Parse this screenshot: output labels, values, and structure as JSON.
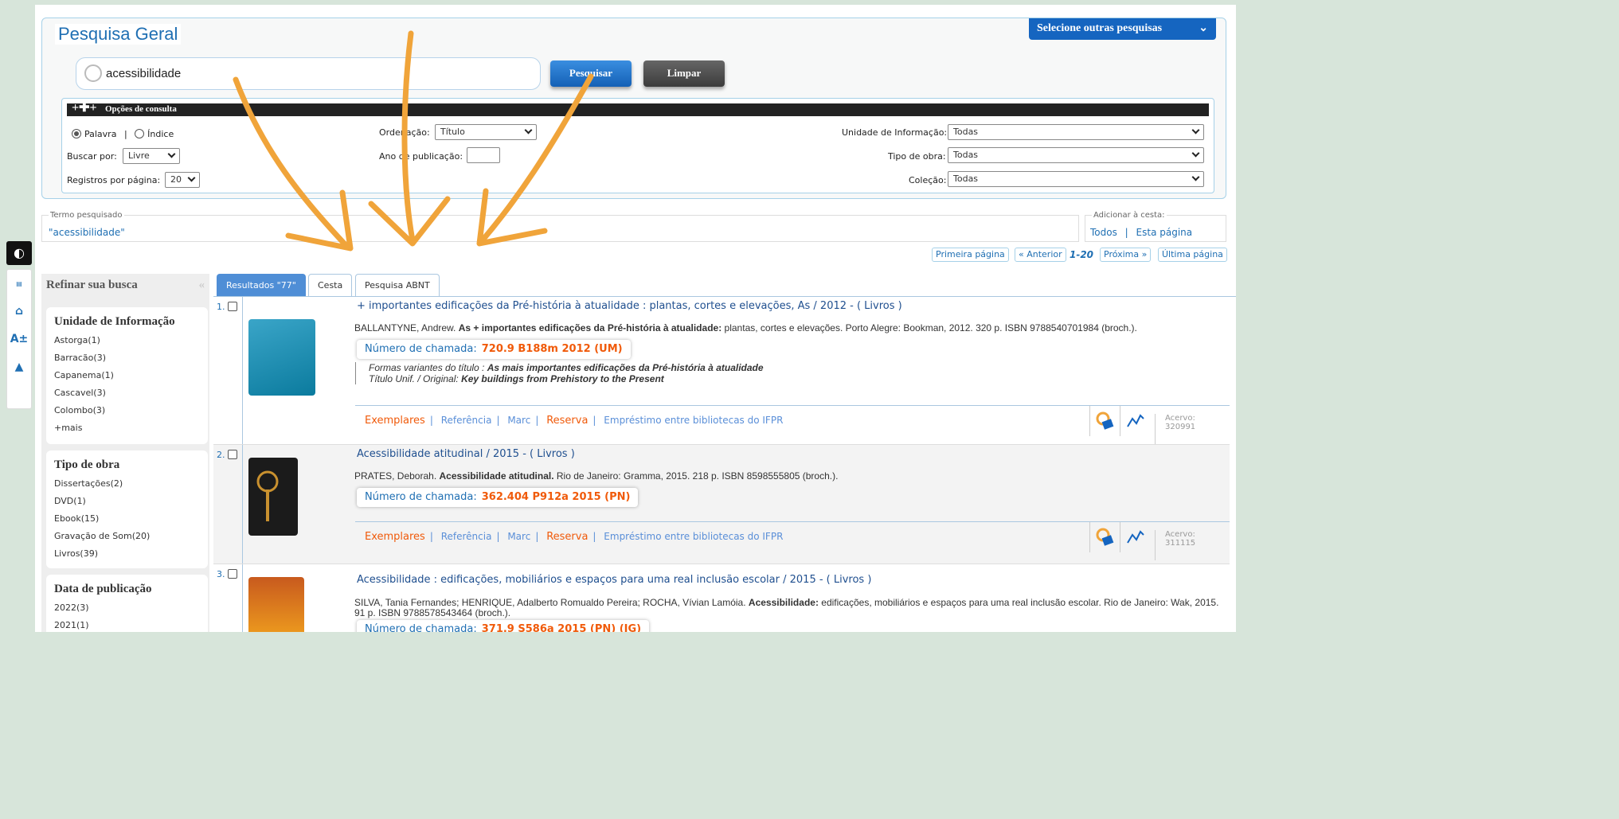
{
  "header": {
    "title": "Pesquisa Geral",
    "other_searches": "Selecione outras pesquisas",
    "search_value": "acessibilidade",
    "search_button": "Pesquisar",
    "clear_button": "Limpar"
  },
  "options": {
    "bar_title": "Opções de consulta",
    "radio_word": "Palavra",
    "radio_index": "Índice",
    "search_by_label": "Buscar por:",
    "search_by_value": "Livre",
    "records_label": "Registros por página:",
    "records_value": "20",
    "order_label": "Ordenação:",
    "order_value": "Título",
    "year_label": "Ano de publicação:",
    "unit_label": "Unidade de Informação:",
    "unit_value": "Todas",
    "type_label": "Tipo de obra:",
    "type_value": "Todas",
    "collection_label": "Coleção:",
    "collection_value": "Todas"
  },
  "term": {
    "label": "Termo pesquisado",
    "value": "\"acessibilidade\"",
    "cart_label": "Adicionar à cesta:",
    "cart_all": "Todos",
    "cart_page": "Esta página"
  },
  "pager": {
    "first": "Primeira página",
    "prev": "« Anterior",
    "current": "1-20",
    "next": "Próxima »",
    "last": "Última página"
  },
  "sidebar": {
    "title": "Refinar sua busca",
    "facets": [
      {
        "title": "Unidade de Informação",
        "items": [
          "Astorga(1)",
          "Barracão(3)",
          "Capanema(1)",
          "Cascavel(3)",
          "Colombo(3)",
          "+mais"
        ]
      },
      {
        "title": "Tipo de obra",
        "items": [
          "Dissertações(2)",
          "DVD(1)",
          "Ebook(15)",
          "Gravação de Som(20)",
          "Livros(39)"
        ]
      },
      {
        "title": "Data de publicação",
        "items": [
          "2022(3)",
          "2021(1)"
        ]
      }
    ]
  },
  "tabs": {
    "results": "Resultados \"77\"",
    "basket": "Cesta",
    "abnt": "Pesquisa ABNT"
  },
  "records": [
    {
      "num": "1.",
      "title": "+ importantes edificações da Pré-história à atualidade : plantas, cortes e elevações, As / 2012 - ( Livros )",
      "ref_author": "BALLANTYNE, Andrew.",
      "ref_bold": "As + importantes edificações da Pré-história à atualidade:",
      "ref_rest": "plantas, cortes e elevações. Porto Alegre: Bookman, 2012. 320 p. ISBN 9788540701984 (broch.).",
      "callno_label": "Número de chamada:",
      "callno": "720.9 B188m 2012 (UM)",
      "variant_label": "Formas variantes do título :",
      "variant_value": "As mais importantes edificações da Pré-história à atualidade",
      "uniform_label": "Título Unif. / Original:",
      "uniform_value": "Key buildings from Prehistory to the Present",
      "acervo_label": "Acervo:",
      "acervo": "320991"
    },
    {
      "num": "2.",
      "title": "Acessibilidade atitudinal / 2015 - ( Livros )",
      "ref_author": "PRATES, Deborah.",
      "ref_bold": "Acessibilidade atitudinal.",
      "ref_rest": "Rio de Janeiro: Gramma, 2015. 218 p. ISBN 8598555805 (broch.).",
      "callno_label": "Número de chamada:",
      "callno": "362.404 P912a 2015 (PN)",
      "acervo_label": "Acervo:",
      "acervo": "311115"
    },
    {
      "num": "3.",
      "title": "Acessibilidade : edificações, mobiliários e espaços para uma real inclusão escolar / 2015 - ( Livros )",
      "ref_author": "SILVA, Tania Fernandes; HENRIQUE, Adalberto Romualdo Pereira; ROCHA, Vívian Lamóia.",
      "ref_bold": "Acessibilidade:",
      "ref_rest": "edificações, mobiliários e espaços para uma real inclusão escolar. Rio de Janeiro: Wak, 2015. 91 p. ISBN 9788578543464 (broch.).",
      "callno_label": "Número de chamada:",
      "callno": "371.9 S586a 2015 (PN) (JG)"
    }
  ],
  "actions": {
    "exemplares": "Exemplares",
    "referencia": "Referência",
    "marc": "Marc",
    "reserva": "Reserva",
    "emprestimo": "Empréstimo entre bibliotecas do IFPR"
  },
  "rail": {
    "menu": "Menu",
    "font": "A±"
  },
  "colors": {
    "accent": "#1565c0",
    "callno": "#f05a0a",
    "arrow": "#f0a43a",
    "frame": "#d7e5da"
  }
}
